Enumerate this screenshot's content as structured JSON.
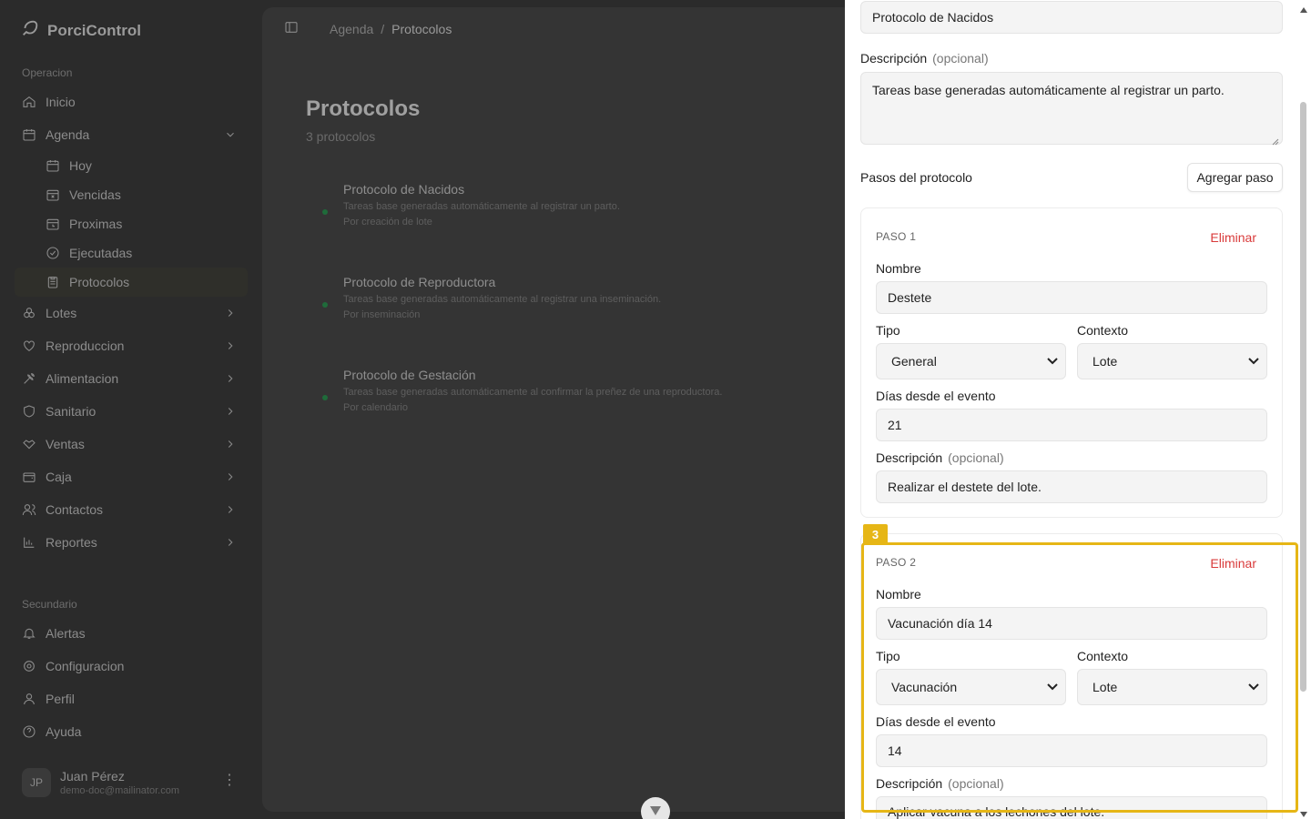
{
  "app": {
    "name": "PorciControl"
  },
  "sidebar": {
    "section_primary": "Operacion",
    "section_secondary": "Secundario",
    "items": [
      {
        "label": "Inicio",
        "icon": "home-icon"
      },
      {
        "label": "Agenda",
        "icon": "calendar-icon",
        "expanded": true
      },
      {
        "label": "Hoy",
        "icon": "calendar-day-icon"
      },
      {
        "label": "Vencidas",
        "icon": "calendar-x-icon"
      },
      {
        "label": "Proximas",
        "icon": "calendar-clock-icon"
      },
      {
        "label": "Ejecutadas",
        "icon": "check-circle-icon"
      },
      {
        "label": "Protocolos",
        "icon": "clipboard-icon",
        "active": true
      },
      {
        "label": "Lotes",
        "icon": "boxes-icon"
      },
      {
        "label": "Reproduccion",
        "icon": "heart-icon"
      },
      {
        "label": "Alimentacion",
        "icon": "wheat-icon"
      },
      {
        "label": "Sanitario",
        "icon": "shield-icon"
      },
      {
        "label": "Ventas",
        "icon": "handshake-icon"
      },
      {
        "label": "Caja",
        "icon": "wallet-icon"
      },
      {
        "label": "Contactos",
        "icon": "users-icon"
      },
      {
        "label": "Reportes",
        "icon": "bar-chart-icon"
      }
    ],
    "secondary_items": [
      {
        "label": "Alertas",
        "icon": "bell-icon"
      },
      {
        "label": "Configuracion",
        "icon": "gear-icon"
      },
      {
        "label": "Perfil",
        "icon": "user-icon"
      },
      {
        "label": "Ayuda",
        "icon": "help-circle-icon"
      }
    ],
    "user": {
      "initials": "JP",
      "name": "Juan Pérez",
      "email": "demo-doc@mailinator.com"
    }
  },
  "main": {
    "breadcrumb": [
      "Agenda",
      "/",
      "Protocolos"
    ],
    "title": "Protocolos",
    "count": "3 protocolos",
    "protocols": [
      {
        "title": "Protocolo de Nacidos",
        "desc": "Tareas base generadas automáticamente al registrar un parto.",
        "meta": "Por creación de lote"
      },
      {
        "title": "Protocolo de Reproductora",
        "desc": "Tareas base generadas automáticamente al registrar una inseminación.",
        "meta": "Por inseminación"
      },
      {
        "title": "Protocolo de Gestación",
        "desc": "Tareas base generadas automáticamente al confirmar la preñez de una reproductora.",
        "meta": "Por calendario"
      }
    ]
  },
  "sheet": {
    "name_value": "Protocolo de Nacidos",
    "desc_label": "Descripción",
    "optional": "(opcional)",
    "desc_value": "Tareas base generadas automáticamente al registrar un parto.",
    "steps_label": "Pasos del protocolo",
    "add_step": "Agregar paso",
    "labels": {
      "nombre": "Nombre",
      "tipo": "Tipo",
      "contexto": "Contexto",
      "dias": "Días desde el evento",
      "descripcion": "Descripción"
    },
    "delete": "Eliminar",
    "steps": [
      {
        "header": "PASO 1",
        "nombre": "Destete",
        "tipo": "General",
        "contexto": "Lote",
        "dias": "21",
        "descripcion": "Realizar el destete del lote."
      },
      {
        "header": "PASO 2",
        "nombre": "Vacunación día 14",
        "tipo": "Vacunación",
        "contexto": "Lote",
        "dias": "14",
        "descripcion": "Aplicar vacuna a los lechones del lote."
      }
    ],
    "highlight_badge": "3",
    "highlight_color": "#e6b616"
  }
}
